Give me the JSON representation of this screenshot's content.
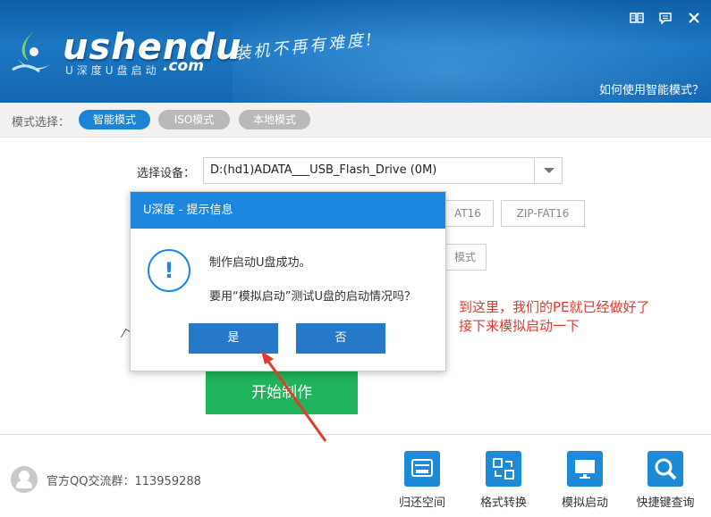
{
  "header": {
    "logo_text": "ushendu",
    "logo_sub": "U深度U盘启动",
    "logo_com": ".com",
    "slogan": "装机不再有难度!",
    "help_link": "如何使用智能模式？",
    "window_icons": [
      "book-icon",
      "message-icon",
      "close-icon"
    ]
  },
  "mode_bar": {
    "label": "模式选择：",
    "modes": [
      {
        "label": "智能模式",
        "active": true
      },
      {
        "label": "ISO模式",
        "active": false
      },
      {
        "label": "本地模式",
        "active": false
      }
    ]
  },
  "device": {
    "label": "选择设备：",
    "value": "D:(hd1)ADATA___USB_Flash_Drive (0M)"
  },
  "options": {
    "format_partial": "AT16",
    "zip_fat16": "ZIP-FAT16",
    "mode_partial": "模式"
  },
  "start_button": "开始制作",
  "annotation": {
    "line1": "到这里，我们的PE就已经做好了",
    "line2": "接下来模拟启动一下"
  },
  "footer": {
    "qq_group": "官方QQ交流群：113959288",
    "tools": [
      {
        "label": "归还空间",
        "icon": "disk-icon"
      },
      {
        "label": "格式转换",
        "icon": "convert-icon"
      },
      {
        "label": "模拟启动",
        "icon": "monitor-icon"
      },
      {
        "label": "快捷键查询",
        "icon": "search-icon"
      }
    ]
  },
  "dialog": {
    "title": "U深度 - 提示信息",
    "message1": "制作启动U盘成功。",
    "message2": "要用“模拟启动”测试U盘的启动情况吗？",
    "yes": "是",
    "no": "否"
  },
  "colors": {
    "accent": "#1d87e0",
    "start_green": "#1fb35b",
    "annotation_red": "#e23a2f"
  }
}
